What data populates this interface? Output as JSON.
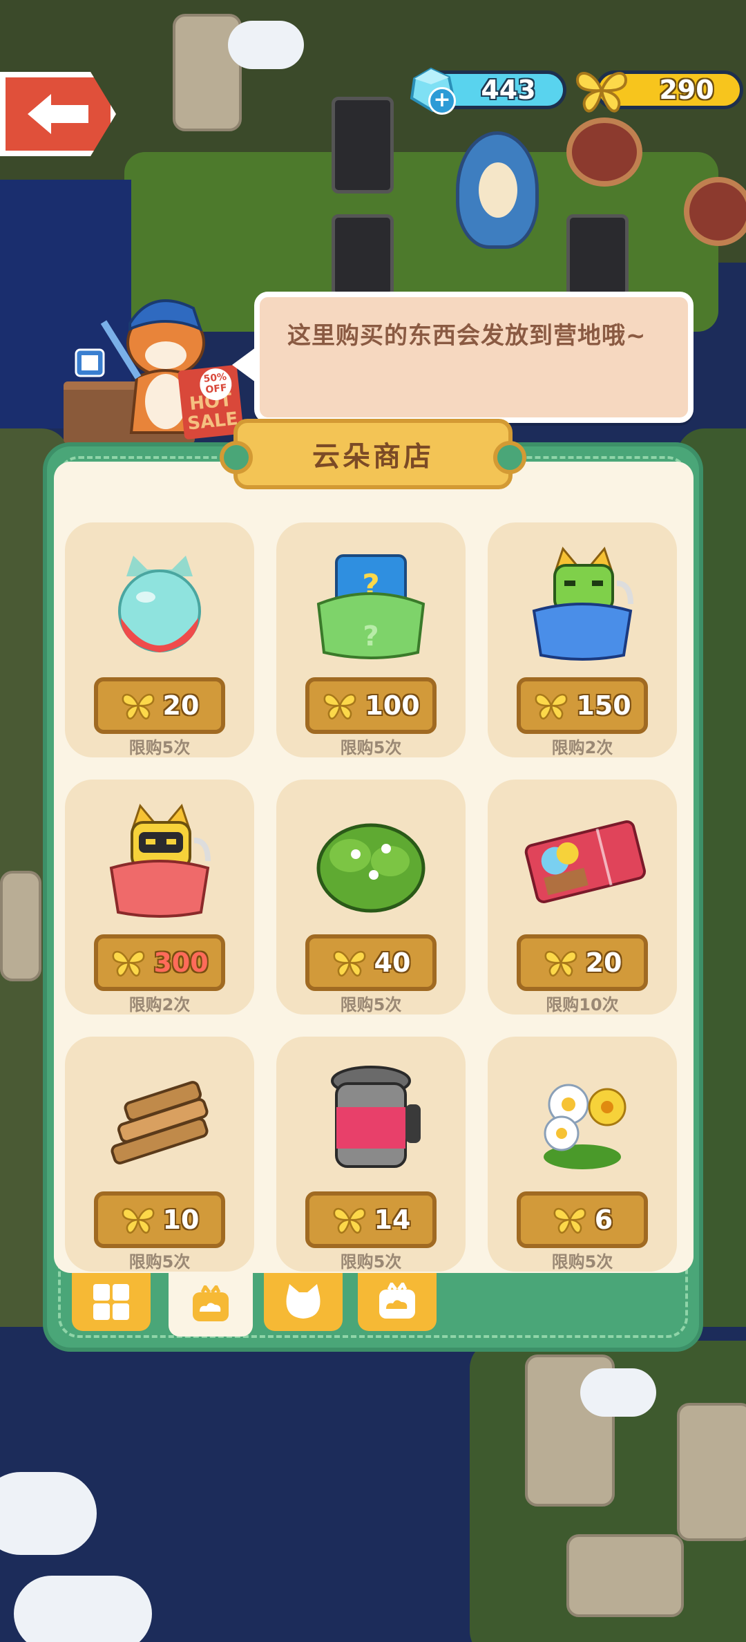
{
  "currencies": {
    "gems": "443",
    "butterflies": "290"
  },
  "speech_bubble": "这里购买的东西会发放到营地哦~",
  "shop": {
    "title": "云朵商店",
    "items": [
      {
        "name": "jelly-pod",
        "price": "20",
        "limit": "限购5次"
      },
      {
        "name": "mystery-bag",
        "price": "100",
        "limit": "限购5次"
      },
      {
        "name": "blue-robot-cat-bag",
        "price": "150",
        "limit": "限购2次"
      },
      {
        "name": "red-robot-cat-bag",
        "price": "300",
        "limit": "限购2次",
        "price_color": "#ff6b5a"
      },
      {
        "name": "green-bush",
        "price": "40",
        "limit": "限购5次"
      },
      {
        "name": "ticket",
        "price": "20",
        "limit": "限购10次"
      },
      {
        "name": "firewood",
        "price": "10",
        "limit": "限购5次"
      },
      {
        "name": "jam-jar",
        "price": "14",
        "limit": "限购5次"
      },
      {
        "name": "flowers",
        "price": "6",
        "limit": "限购5次"
      }
    ],
    "tabs": [
      {
        "name": "tab-all",
        "icon": "grid-icon",
        "active": false
      },
      {
        "name": "tab-cloud",
        "icon": "cloud-bag-icon",
        "active": true
      },
      {
        "name": "tab-cat",
        "icon": "cat-icon",
        "active": false
      },
      {
        "name": "tab-cloud-2",
        "icon": "cloud-bag-icon",
        "active": false
      }
    ]
  },
  "hot_sale": {
    "badge": "50% OFF",
    "line1": "HOT",
    "line2": "SALE"
  },
  "colors": {
    "panel": "#4aa678",
    "card": "#f4e2c2",
    "price": "#d29a3a",
    "gem_bar": "#59d3ee",
    "butterfly_bar": "#f7c51d"
  }
}
